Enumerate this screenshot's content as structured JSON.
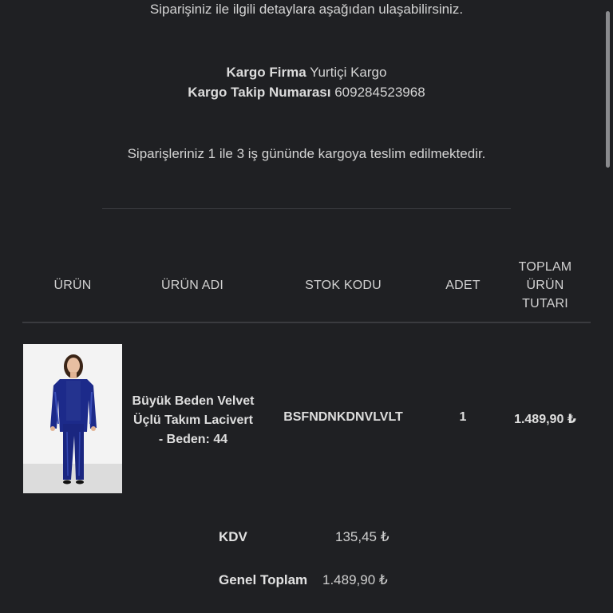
{
  "intro": "Siparişiniz ile ilgili detaylara aşağıdan ulaşabilirsiniz.",
  "shipping": {
    "carrier_label": "Kargo Firma",
    "carrier_value": "Yurtiçi Kargo",
    "tracking_label": "Kargo Takip Numarası",
    "tracking_value": "609284523968"
  },
  "delivery_note": "Siparişleriniz 1 ile 3 iş gününde kargoya teslim edilmektedir.",
  "table": {
    "headers": {
      "product": "ÜRÜN",
      "product_name": "ÜRÜN ADI",
      "stock_code": "STOK KODU",
      "quantity": "ADET",
      "total_line1": "TOPLAM",
      "total_line2": "ÜRÜN",
      "total_line3": "TUTARI"
    },
    "rows": [
      {
        "name_line1": "Büyük Beden Velvet",
        "name_line2": "Üçlü Takım Lacivert",
        "name_line3": "- Beden: 44",
        "stock_code": "BSFNDNKDNVLVLT",
        "quantity": "1",
        "total": "1.489,90 ₺"
      }
    ]
  },
  "totals": {
    "vat_label": "KDV",
    "vat_value": "135,45 ₺",
    "grand_label": "Genel Toplam",
    "grand_value": "1.489,90 ₺"
  },
  "colors": {
    "background": "#1f2023",
    "text": "#d6d6d6",
    "product_velvet": "#1c2a8a"
  },
  "icons": {
    "product_image": "product-photo-velvet-suit"
  }
}
